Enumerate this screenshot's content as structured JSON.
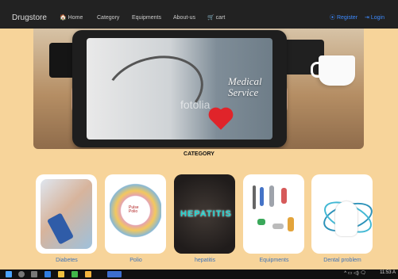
{
  "navbar": {
    "brand": "Drugstore",
    "links": [
      "Home",
      "Category",
      "Equipments",
      "About-us",
      "cart"
    ],
    "right_links": [
      "Register",
      "Login"
    ]
  },
  "hero": {
    "text_line1": "Medical",
    "text_line2": "Service",
    "watermark": "fotolia"
  },
  "section_title": "CATEGORY",
  "categories": [
    {
      "label": "Diabetes"
    },
    {
      "label": "Polio"
    },
    {
      "label": "hepatitis"
    },
    {
      "label": "Equipments"
    },
    {
      "label": "Dental problem"
    }
  ],
  "hepatitis_word": "HEPATITIS",
  "polio_badge": "Pulse Polio",
  "taskbar": {
    "time": "11:53 A",
    "tray": "^ ▭ ◁) 🗨"
  },
  "colors": {
    "page_bg": "#f7d49a",
    "navbar_bg": "#222222",
    "link_blue": "#3d8bff",
    "caption_blue": "#3f73b7"
  }
}
